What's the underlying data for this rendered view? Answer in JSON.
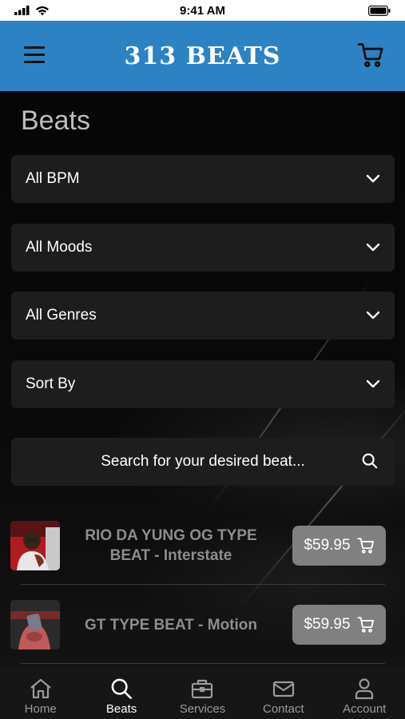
{
  "status_bar": {
    "time": "9:41 AM"
  },
  "header": {
    "logo": "313 BEATS"
  },
  "page": {
    "title": "Beats"
  },
  "filters": [
    {
      "label": "All BPM"
    },
    {
      "label": "All Moods"
    },
    {
      "label": "All Genres"
    },
    {
      "label": "Sort By"
    }
  ],
  "search": {
    "placeholder": "Search for your desired beat..."
  },
  "beats": [
    {
      "title": "RIO DA YUNG OG TYPE BEAT - Interstate",
      "price": "$59.95"
    },
    {
      "title": "GT TYPE BEAT - Motion",
      "price": "$59.95"
    }
  ],
  "tabs": [
    {
      "label": "Home",
      "icon": "home-icon",
      "active": false
    },
    {
      "label": "Beats",
      "icon": "search-icon",
      "active": true
    },
    {
      "label": "Services",
      "icon": "briefcase-icon",
      "active": false
    },
    {
      "label": "Contact",
      "icon": "envelope-icon",
      "active": false
    },
    {
      "label": "Account",
      "icon": "user-icon",
      "active": false
    }
  ],
  "colors": {
    "header": "#2d82c4",
    "price_button": "#808080",
    "card": "#1d1d1d"
  }
}
